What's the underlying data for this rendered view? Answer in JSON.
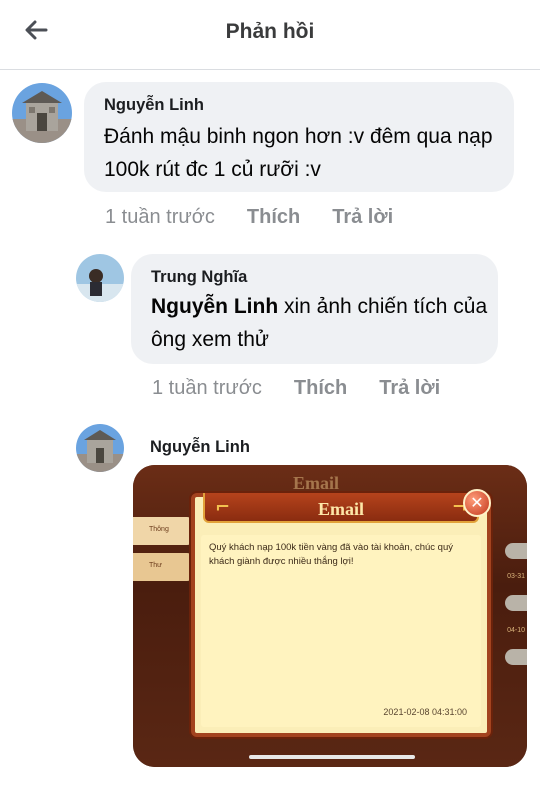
{
  "header": {
    "title": "Phản hồi",
    "back_icon": "arrow-left-icon"
  },
  "comments": [
    {
      "author": "Nguyễn Linh",
      "text": "Đánh mậu binh ngon hơn :v đêm qua nạp 100k rút đc 1 củ rưỡi :v",
      "time": "1 tuần trước",
      "like": "Thích",
      "reply": "Trả lời"
    },
    {
      "author": "Trung Nghĩa",
      "mention": "Nguyễn Linh",
      "text": " xin ảnh chiến tích của ông xem thử",
      "time": "1 tuần trước",
      "like": "Thích",
      "reply": "Trả lời"
    },
    {
      "author": "Nguyễn Linh",
      "attachment": {
        "bg_title": "Email",
        "dialog_title": "Email",
        "close_icon": "close-icon",
        "side_labels": [
          "Thông",
          "Thư"
        ],
        "right_labels": [
          "03-31",
          "04-10"
        ],
        "message": "Quý khách nạp 100k tiền vàng đã vào tài khoản, chúc quý khách giành được nhiều thắng lợi!",
        "timestamp": "2021-02-08 04:31:00"
      }
    }
  ],
  "colors": {
    "bubble": "#eff1f4",
    "meta_text": "#8a8d91",
    "dialog_frame": "#a3431f",
    "dialog_paper": "#fff3bf"
  }
}
